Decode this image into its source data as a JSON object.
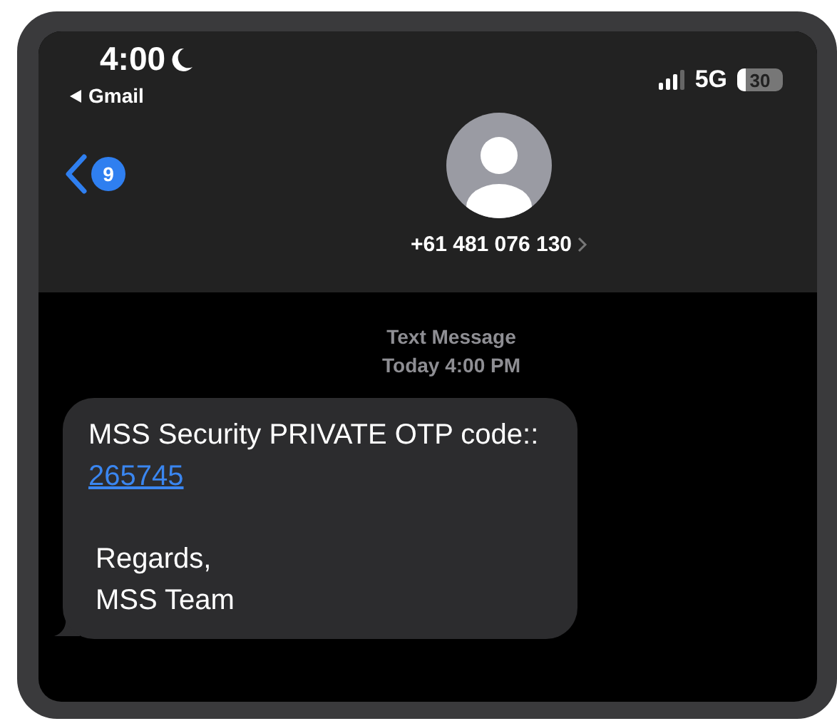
{
  "status_bar": {
    "time": "4:00",
    "back_app": "Gmail",
    "network": "5G",
    "battery": "30"
  },
  "header": {
    "unread_count": "9",
    "contact": "+61 481 076 130"
  },
  "conversation": {
    "label": "Text Message",
    "timestamp": "Today 4:00 PM",
    "messages": [
      {
        "text": "MSS Security PRIVATE OTP code::",
        "code": "265745",
        "signoff": [
          "Regards,",
          "MSS Team"
        ]
      }
    ]
  }
}
